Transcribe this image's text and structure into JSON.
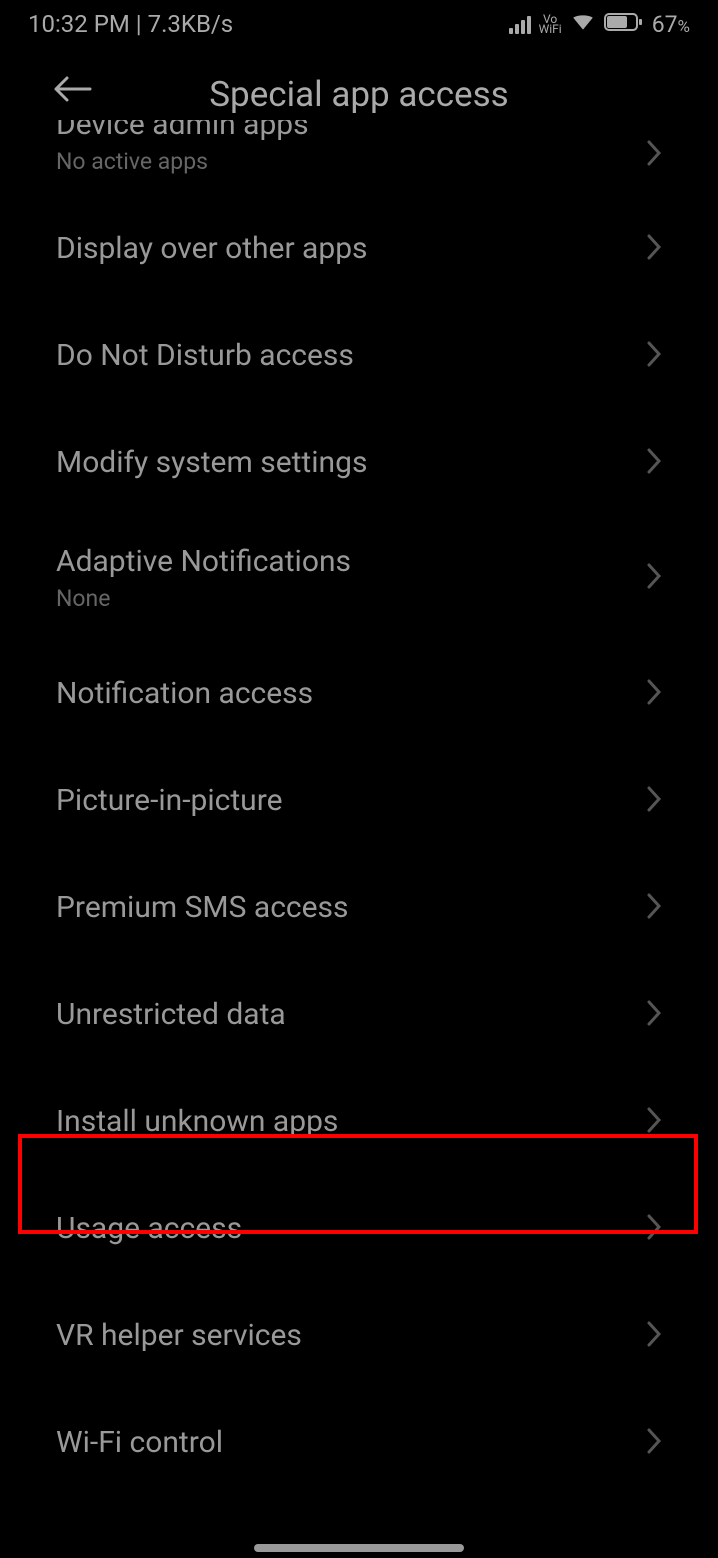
{
  "status": {
    "time": "10:32 PM",
    "speed": "7.3KB/s",
    "vowifi_top": "Vo",
    "vowifi_bottom": "WiFi",
    "battery": "67"
  },
  "header": {
    "title": "Special app access"
  },
  "items": [
    {
      "label": "Device admin apps",
      "sub": "No active apps",
      "partial": true
    },
    {
      "label": "Display over other apps"
    },
    {
      "label": "Do Not Disturb access"
    },
    {
      "label": "Modify system settings"
    },
    {
      "label": "Adaptive Notifications",
      "sub": "None"
    },
    {
      "label": "Notification access"
    },
    {
      "label": "Picture-in-picture"
    },
    {
      "label": "Premium SMS access"
    },
    {
      "label": "Unrestricted data"
    },
    {
      "label": "Install unknown apps",
      "highlighted": true
    },
    {
      "label": "Usage access"
    },
    {
      "label": "VR helper services"
    },
    {
      "label": "Wi-Fi control"
    }
  ]
}
